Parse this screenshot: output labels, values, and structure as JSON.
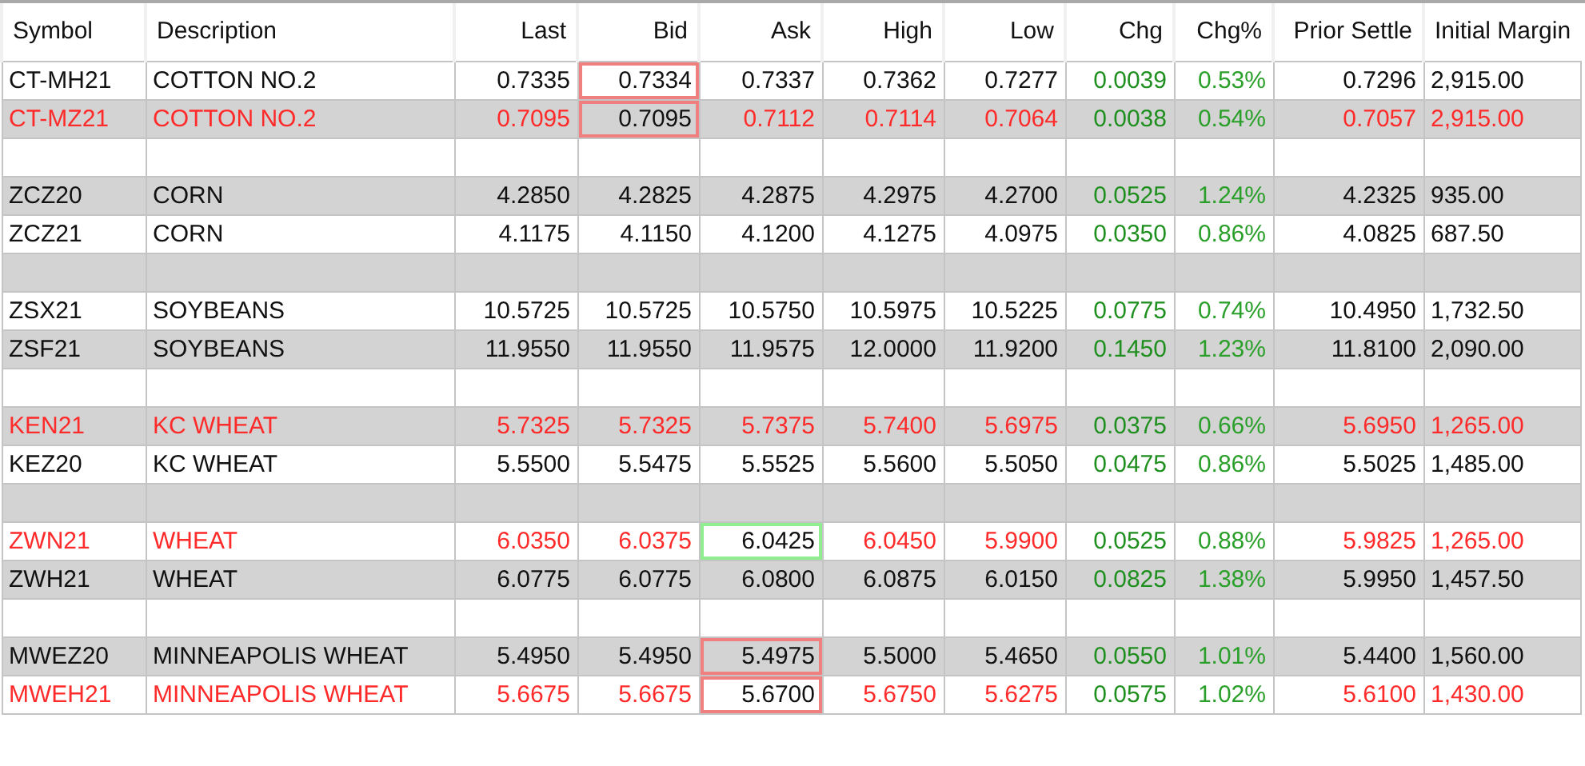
{
  "table": {
    "columns": [
      "Symbol",
      "Description",
      "Last",
      "Bid",
      "Ask",
      "High",
      "Low",
      "Chg",
      "Chg%",
      "Prior Settle",
      "Initial Margin"
    ],
    "rows": [
      {
        "kind": "quote",
        "alert": false,
        "cells": [
          "CT-MH21",
          "COTTON NO.2",
          "0.7335",
          {
            "text": "0.7334",
            "color": "#f08080"
          },
          "0.7337",
          "0.7362",
          "0.7277",
          "0.0039",
          "0.53%",
          "0.7296",
          "2,915.00"
        ]
      },
      {
        "kind": "quote",
        "alert": true,
        "cells": [
          "CT-MZ21",
          "COTTON NO.2",
          "0.7095",
          {
            "text": "0.7095",
            "color": "#f08080"
          },
          "0.7112",
          "0.7114",
          "0.7064",
          "0.0038",
          "0.54%",
          "0.7057",
          "2,915.00"
        ]
      },
      {
        "kind": "blank"
      },
      {
        "kind": "quote",
        "alert": false,
        "cells": [
          "ZCZ20",
          "CORN",
          "4.2850",
          "4.2825",
          "4.2875",
          "4.2975",
          "4.2700",
          "0.0525",
          "1.24%",
          "4.2325",
          "935.00"
        ]
      },
      {
        "kind": "quote",
        "alert": false,
        "cells": [
          "ZCZ21",
          "CORN",
          "4.1175",
          "4.1150",
          "4.1200",
          "4.1275",
          "4.0975",
          "0.0350",
          "0.86%",
          "4.0825",
          "687.50"
        ]
      },
      {
        "kind": "blank"
      },
      {
        "kind": "quote",
        "alert": false,
        "cells": [
          "ZSX21",
          "SOYBEANS",
          "10.5725",
          "10.5725",
          "10.5750",
          "10.5975",
          "10.5225",
          "0.0775",
          "0.74%",
          "10.4950",
          "1,732.50"
        ]
      },
      {
        "kind": "quote",
        "alert": false,
        "cells": [
          "ZSF21",
          "SOYBEANS",
          "11.9550",
          "11.9550",
          "11.9575",
          "12.0000",
          "11.9200",
          "0.1450",
          "1.23%",
          "11.8100",
          "2,090.00"
        ]
      },
      {
        "kind": "blank"
      },
      {
        "kind": "quote",
        "alert": true,
        "cells": [
          "KEN21",
          "KC WHEAT",
          "5.7325",
          "5.7325",
          "5.7375",
          "5.7400",
          "5.6975",
          "0.0375",
          "0.66%",
          "5.6950",
          "1,265.00"
        ]
      },
      {
        "kind": "quote",
        "alert": false,
        "cells": [
          "KEZ20",
          "KC WHEAT",
          "5.5500",
          "5.5475",
          "5.5525",
          "5.5600",
          "5.5050",
          "0.0475",
          "0.86%",
          "5.5025",
          "1,485.00"
        ]
      },
      {
        "kind": "blank"
      },
      {
        "kind": "quote",
        "alert": true,
        "cells": [
          "ZWN21",
          "WHEAT",
          "6.0350",
          "6.0375",
          {
            "text": "6.0425",
            "color": "#90ee90"
          },
          "6.0450",
          "5.9900",
          "0.0525",
          "0.88%",
          "5.9825",
          "1,265.00"
        ]
      },
      {
        "kind": "quote",
        "alert": false,
        "cells": [
          "ZWH21",
          "WHEAT",
          "6.0775",
          "6.0775",
          "6.0800",
          "6.0875",
          "6.0150",
          "0.0825",
          "1.38%",
          "5.9950",
          "1,457.50"
        ]
      },
      {
        "kind": "blank"
      },
      {
        "kind": "quote",
        "alert": false,
        "cells": [
          "MWEZ20",
          "MINNEAPOLIS WHEAT",
          "5.4950",
          "5.4950",
          {
            "text": "5.4975",
            "color": "#f08080"
          },
          "5.5000",
          "5.4650",
          "0.0550",
          "1.01%",
          "5.4400",
          "1,560.00"
        ]
      },
      {
        "kind": "quote",
        "alert": true,
        "cells": [
          "MWEH21",
          "MINNEAPOLIS WHEAT",
          "5.6675",
          "5.6675",
          {
            "text": "5.6700",
            "color": "#f08080"
          },
          "5.6750",
          "5.6275",
          "0.0575",
          "1.02%",
          "5.6100",
          "1,430.00"
        ]
      }
    ]
  }
}
